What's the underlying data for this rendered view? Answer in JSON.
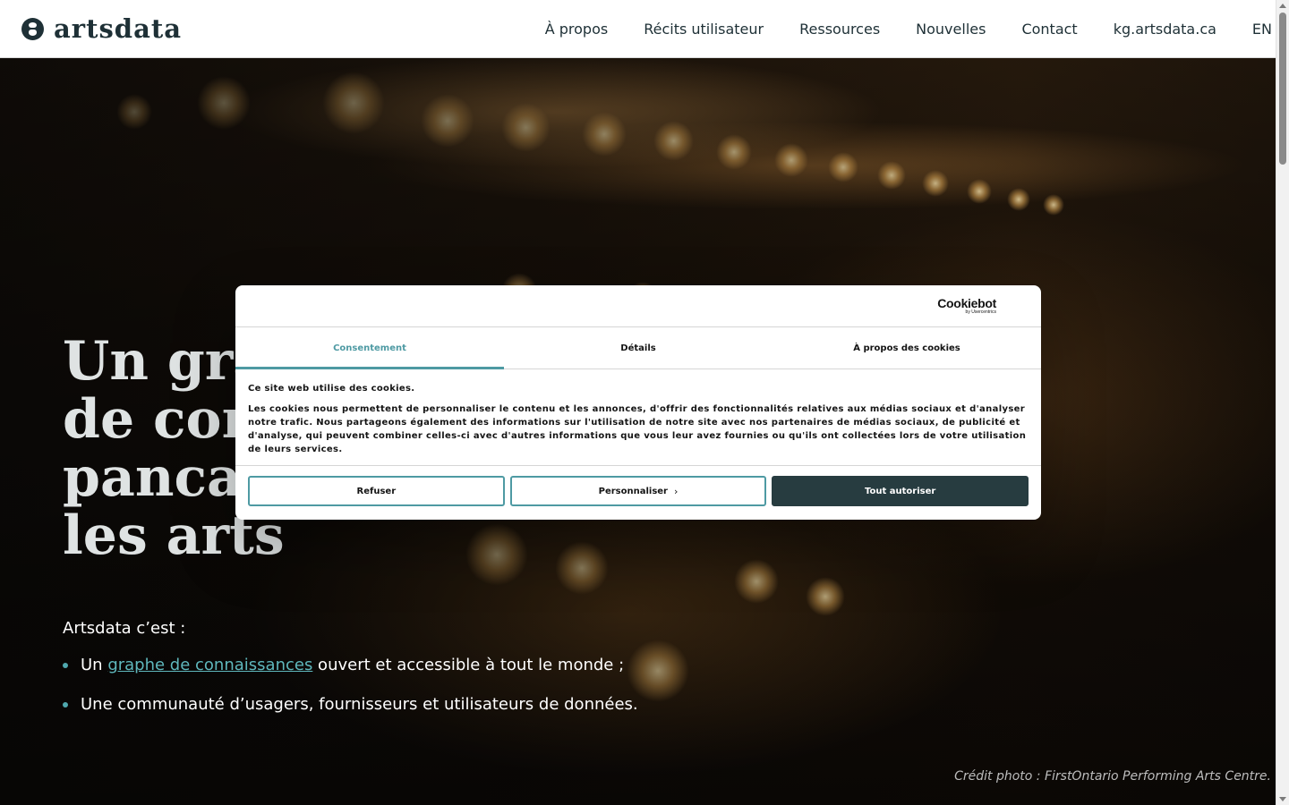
{
  "header": {
    "logo_text": "artsdata",
    "nav": [
      {
        "label": "À propos"
      },
      {
        "label": "Récits utilisateur"
      },
      {
        "label": "Ressources"
      },
      {
        "label": "Nouvelles"
      },
      {
        "label": "Contact"
      },
      {
        "label": "kg.artsdata.ca"
      },
      {
        "label": "EN"
      }
    ]
  },
  "hero": {
    "title_lines": [
      "Un graphe",
      "de connaissances",
      "pancanadien pour",
      "les arts"
    ],
    "intro": "Artsdata c’est :",
    "bullet_1_prefix": "Un ",
    "bullet_1_link": "graphe de connaissances",
    "bullet_1_suffix": " ouvert et accessible à tout le monde ;",
    "bullet_2": "Une communauté d’usagers, fournisseurs et utilisateurs de données.",
    "credit": "Crédit photo : FirstOntario Performing Arts Centre."
  },
  "cookie_dialog": {
    "brand": "Cookiebot",
    "brand_sub": "by Usercentrics",
    "tabs": [
      {
        "label": "Consentement",
        "active": true
      },
      {
        "label": "Détails",
        "active": false
      },
      {
        "label": "À propos des cookies",
        "active": false
      }
    ],
    "title": "Ce site web utilise des cookies.",
    "text": "Les cookies nous permettent de personnaliser le contenu et les annonces, d'offrir des fonctionnalités relatives aux médias sociaux et d'analyser notre trafic. Nous partageons également des informations sur l'utilisation de notre site avec nos partenaires de médias sociaux, de publicité et d'analyse, qui peuvent combiner celles-ci avec d'autres informations que vous leur avez fournies ou qu'ils ont collectées lors de votre utilisation de leurs services.",
    "buttons": {
      "refuse": "Refuser",
      "customize": "Personnaliser",
      "allow_all": "Tout autoriser"
    }
  },
  "colors": {
    "brand_dark": "#1e3036",
    "accent_teal": "#4e9aa3",
    "button_dark": "#273c40"
  }
}
